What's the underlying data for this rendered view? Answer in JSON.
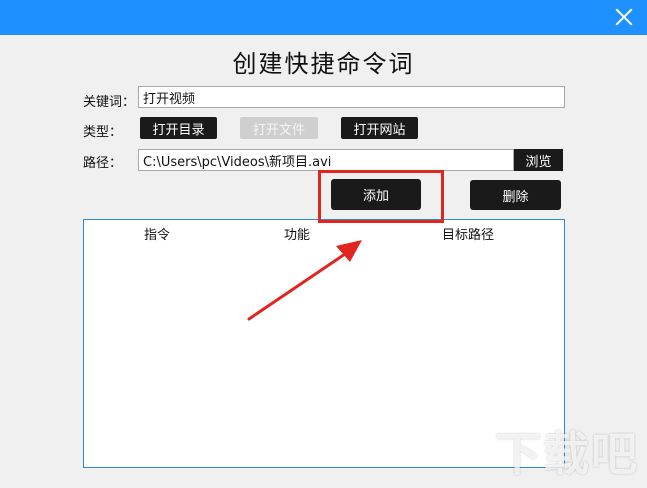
{
  "window": {
    "title": "创建快捷命令词"
  },
  "form": {
    "keyword_label": "关键词：",
    "keyword_value": "打开视频",
    "type_label": "类型：",
    "type_buttons": [
      {
        "label": "打开目录",
        "enabled": true
      },
      {
        "label": "打开文件",
        "enabled": false
      },
      {
        "label": "打开网站",
        "enabled": true
      }
    ],
    "path_label": "路径：",
    "path_value": "C:\\Users\\pc\\Videos\\新项目.avi",
    "browse_label": "浏览"
  },
  "actions": {
    "add_label": "添加",
    "delete_label": "删除"
  },
  "table": {
    "columns": [
      "指令",
      "功能",
      "目标路径"
    ],
    "rows": []
  },
  "annotation": {
    "highlight_color": "#e0261f",
    "arrow_color": "#e0261f"
  },
  "watermark": {
    "text": "下载吧"
  },
  "colors": {
    "titlebar": "#1e90ff",
    "button_dark": "#1a1a1a",
    "list_border": "#2a8bdc"
  }
}
